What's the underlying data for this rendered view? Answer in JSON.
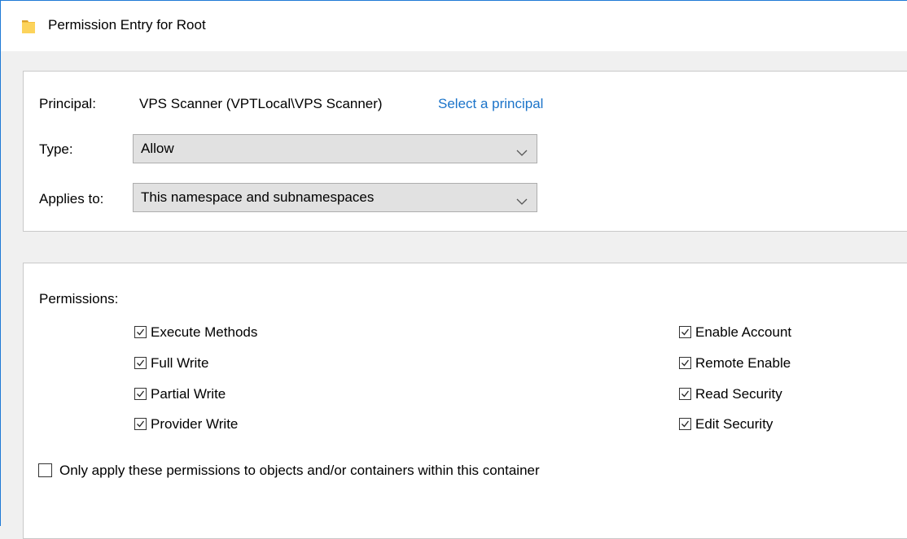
{
  "window": {
    "title": "Permission Entry for Root",
    "icon": "folder-icon",
    "accent_color": "#1f7ad6"
  },
  "principal": {
    "label": "Principal:",
    "value": "VPS Scanner (VPTLocal\\VPS Scanner)",
    "link": "Select a principal"
  },
  "type": {
    "label": "Type:",
    "selected": "Allow"
  },
  "applies_to": {
    "label": "Applies to:",
    "selected": "This namespace and subnamespaces"
  },
  "permissions": {
    "label": "Permissions:",
    "left": [
      {
        "label": "Execute Methods",
        "checked": true
      },
      {
        "label": "Full Write",
        "checked": true
      },
      {
        "label": "Partial Write",
        "checked": true
      },
      {
        "label": "Provider Write",
        "checked": true
      }
    ],
    "right": [
      {
        "label": "Enable Account",
        "checked": true
      },
      {
        "label": "Remote Enable",
        "checked": true
      },
      {
        "label": "Read Security",
        "checked": true
      },
      {
        "label": "Edit Security",
        "checked": true
      }
    ]
  },
  "only_apply": {
    "label": "Only apply these permissions to objects and/or containers within this container",
    "checked": false
  }
}
